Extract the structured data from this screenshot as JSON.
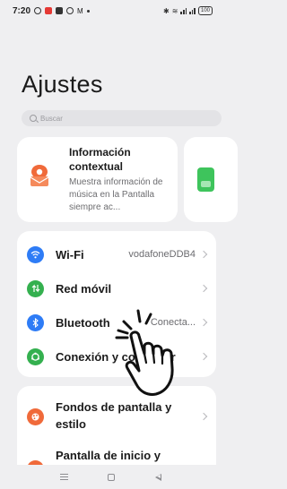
{
  "status_bar": {
    "time": "7:20",
    "battery": "100"
  },
  "page": {
    "title": "Ajustes"
  },
  "search": {
    "placeholder": "Buscar"
  },
  "context_card": {
    "title": "Información contextual",
    "description": "Muestra información de música en la Pantalla siempre ac..."
  },
  "settings": {
    "items": [
      {
        "label": "Wi-Fi",
        "value": "vodafoneDDB4",
        "icon": "wifi-icon",
        "color": "#2e7cf6"
      },
      {
        "label": "Red móvil",
        "value": "",
        "icon": "mobile-network-icon",
        "color": "#34b04f"
      },
      {
        "label": "Bluetooth",
        "value": "Conecta...",
        "icon": "bluetooth-icon",
        "color": "#2e7cf6"
      },
      {
        "label": "Conexión y compartir",
        "value": "",
        "icon": "connection-share-icon",
        "color": "#34b04f"
      }
    ],
    "items2": [
      {
        "label": "Fondos de pantalla y estilo",
        "icon": "wallpaper-style-icon",
        "color": "#f06a3a"
      },
      {
        "label": "Pantalla de inicio y",
        "icon": "home-screen-icon",
        "color": "#f06a3a"
      }
    ]
  },
  "colors": {
    "background": "#efeff1",
    "card": "#ffffff",
    "accent_blue": "#2e7cf6",
    "accent_green": "#34b04f",
    "accent_orange": "#f06a3a"
  }
}
